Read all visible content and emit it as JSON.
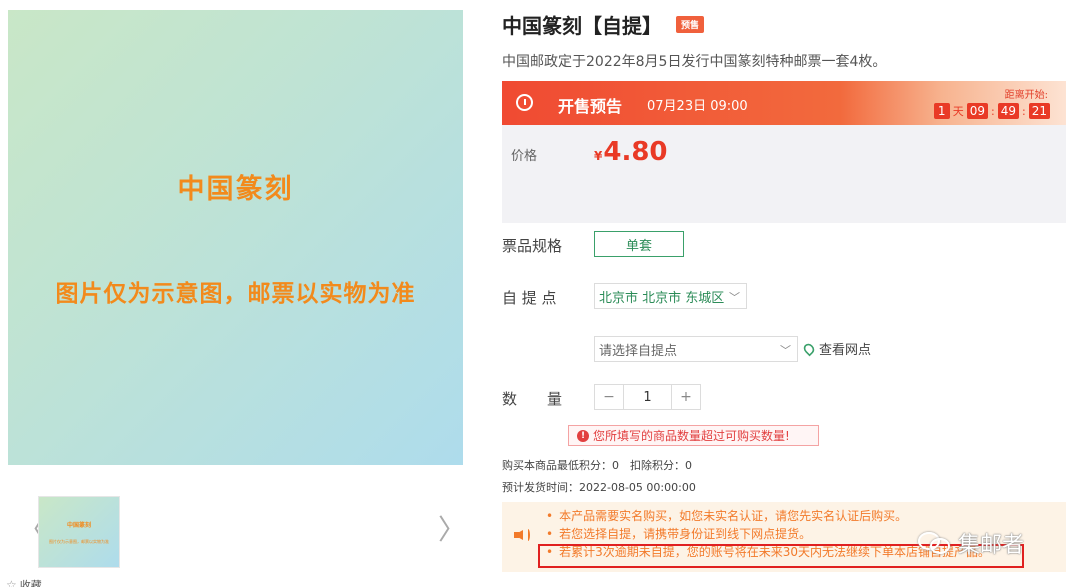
{
  "gallery": {
    "image_title": "中国篆刻",
    "image_caption": "图片仅为示意图，邮票以实物为准",
    "thumb_title": "中国篆刻",
    "thumb_caption": "图片仅为示意图，邮票以实物为准",
    "prev_arrow": "〈",
    "next_arrow": "〉",
    "favorite_label": "收藏"
  },
  "product": {
    "title": "中国篆刻【自提】",
    "badge": "预售",
    "subtitle": "中国邮政定于2022年8月5日发行中国篆刻特种邮票一套4枚。"
  },
  "presale": {
    "label": "开售预告",
    "time": "07月23日 09:00",
    "countdown_label": "距离开始:",
    "days": "1",
    "day_unit": "天",
    "hours": "09",
    "minutes": "49",
    "seconds": "21",
    "sep": ":"
  },
  "price": {
    "label": "价格",
    "currency": "¥",
    "value": "4.80"
  },
  "spec": {
    "label": "票品规格",
    "option": "单套"
  },
  "pickup": {
    "label": "自 提 点",
    "city_value": "北京市 北京市 东城区",
    "point_placeholder": "请选择自提点",
    "view_points": "查看网点"
  },
  "quantity": {
    "label": "数　　量",
    "minus": "−",
    "value": "1",
    "plus": "+"
  },
  "warning": "您所填写的商品数量超过可购买数量!",
  "meta": {
    "points": "购买本商品最低积分：0　扣除积分：0",
    "ship_time": "预计发货时间：2022-08-05 00:00:00"
  },
  "notices": [
    "本产品需要实名购买，如您未实名认证，请您先实名认证后购买。",
    "若您选择自提，请携带身份证到线下网点提货。",
    "若累计3次逾期未自提，您的账号将在未来30天内无法继续下单本店铺自提产品。"
  ],
  "watermark": "集邮者",
  "colors": {
    "accent_red": "#e93a26",
    "accent_green": "#3aa06a",
    "notice_orange": "#f27a2a",
    "image_text_orange": "#f28a1c"
  }
}
